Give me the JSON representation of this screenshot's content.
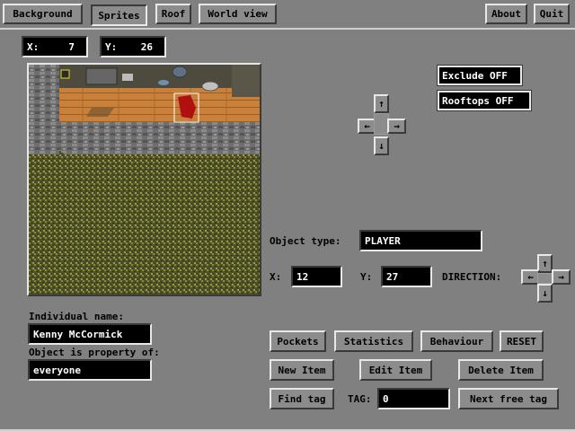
{
  "topbar": {
    "background": "Background",
    "sprites": "Sprites",
    "roof": "Roof",
    "world_view": "World view",
    "about": "About",
    "quit": "Quit"
  },
  "coords": {
    "x_text": "X:     7",
    "y_text": "Y:    26"
  },
  "toggles": {
    "exclude": "Exclude OFF",
    "rooftops": "Rooftops OFF"
  },
  "arrows": {
    "up": "↑",
    "down": "↓",
    "left": "←",
    "right": "→"
  },
  "object": {
    "type_label": "Object type:",
    "type_value": "PLAYER",
    "x_label": "X:",
    "x_value": "12",
    "y_label": "Y:",
    "y_value": "27",
    "direction_label": "DIRECTION:"
  },
  "individual": {
    "name_label": "Individual name:",
    "name_value": "Kenny McCormick",
    "owner_label": "Object is property of:",
    "owner_value": "everyone"
  },
  "actions": {
    "pockets": "Pockets",
    "statistics": "Statistics",
    "behaviour": "Behaviour",
    "reset": "RESET",
    "new_item": "New Item",
    "edit_item": "Edit Item",
    "delete_item": "Delete Item",
    "find_tag": "Find tag",
    "tag_label": "TAG:",
    "tag_value": "0",
    "next_free_tag": "Next free tag"
  },
  "colors": {
    "panel": "#808080",
    "field_bg": "#000000",
    "floor": "#c8803a",
    "grass": "#5a5a2a",
    "wall": "#707070"
  }
}
